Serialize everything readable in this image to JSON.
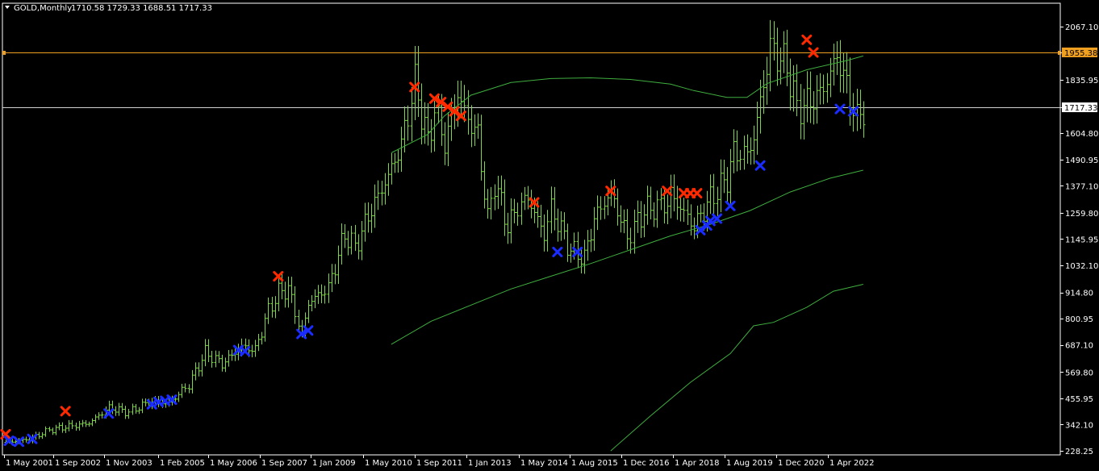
{
  "header": {
    "symbol_period": "GOLD,Monthly",
    "ohlc": "1710.58 1729.33 1688.51 1717.33"
  },
  "colors": {
    "background": "#000000",
    "frame": "#ffffff",
    "bar": "#7fd64a",
    "ma": "#3fae3f",
    "sell_marker": "#ff2a00",
    "buy_marker": "#1a2cff",
    "level_line": "#f0a020",
    "price_line": "#d0d0d0"
  },
  "chart_data": {
    "type": "ohlc",
    "title": "GOLD,Monthly",
    "ylim": [
      228.25,
      2126.0
    ],
    "y_ticks": [
      "2067.10",
      "1955.38",
      "1835.95",
      "1717.33",
      "1604.80",
      "1490.95",
      "1377.10",
      "1259.80",
      "1145.95",
      "1032.10",
      "914.80",
      "800.95",
      "687.10",
      "569.80",
      "455.95",
      "342.10",
      "228.25"
    ],
    "x_ticks": [
      "1 May 2001",
      "1 Sep 2002",
      "1 Nov 2003",
      "1 Feb 2005",
      "1 May 2006",
      "1 Sep 2007",
      "1 Jan 2009",
      "1 May 2010",
      "1 Sep 2011",
      "1 Jan 2013",
      "1 May 2014",
      "1 Aug 2015",
      "1 Dec 2016",
      "1 Apr 2018",
      "1 Aug 2019",
      "1 Dec 2020",
      "1 Apr 2022"
    ],
    "x_start": "2001-05",
    "x_step": "1 month",
    "horizontal_lines": [
      {
        "label": "1955.38",
        "value": 1955.38,
        "kind": "level"
      },
      {
        "label": "1717.33",
        "value": 1717.33,
        "kind": "current-price"
      }
    ],
    "close_anchors": [
      [
        "2001-05",
        265
      ],
      [
        "2001-12",
        278
      ],
      [
        "2002-06",
        318
      ],
      [
        "2002-10",
        330
      ],
      [
        "2003-06",
        348
      ],
      [
        "2003-12",
        415
      ],
      [
        "2004-06",
        395
      ],
      [
        "2004-12",
        440
      ],
      [
        "2005-06",
        435
      ],
      [
        "2005-12",
        515
      ],
      [
        "2006-05",
        655
      ],
      [
        "2006-10",
        605
      ],
      [
        "2007-04",
        680
      ],
      [
        "2007-08",
        665
      ],
      [
        "2007-12",
        835
      ],
      [
        "2008-03",
        915
      ],
      [
        "2008-06",
        930
      ],
      [
        "2008-10",
        730
      ],
      [
        "2008-12",
        870
      ],
      [
        "2009-06",
        935
      ],
      [
        "2009-11",
        1170
      ],
      [
        "2010-02",
        1110
      ],
      [
        "2010-06",
        1245
      ],
      [
        "2010-12",
        1420
      ],
      [
        "2011-04",
        1555
      ],
      [
        "2011-08",
        1825
      ],
      [
        "2011-12",
        1565
      ],
      [
        "2012-02",
        1710
      ],
      [
        "2012-05",
        1560
      ],
      [
        "2012-09",
        1775
      ],
      [
        "2012-12",
        1665
      ],
      [
        "2013-03",
        1595
      ],
      [
        "2013-06",
        1230
      ],
      [
        "2013-08",
        1395
      ],
      [
        "2013-12",
        1200
      ],
      [
        "2014-03",
        1285
      ],
      [
        "2014-06",
        1325
      ],
      [
        "2014-11",
        1165
      ],
      [
        "2015-01",
        1280
      ],
      [
        "2015-07",
        1095
      ],
      [
        "2015-11",
        1065
      ],
      [
        "2016-02",
        1235
      ],
      [
        "2016-07",
        1350
      ],
      [
        "2016-12",
        1150
      ],
      [
        "2017-05",
        1270
      ],
      [
        "2017-12",
        1300
      ],
      [
        "2018-01",
        1340
      ],
      [
        "2018-08",
        1200
      ],
      [
        "2019-01",
        1320
      ],
      [
        "2019-06",
        1410
      ],
      [
        "2019-08",
        1520
      ],
      [
        "2019-12",
        1515
      ],
      [
        "2020-02",
        1585
      ],
      [
        "2020-07",
        1975
      ],
      [
        "2020-12",
        1895
      ],
      [
        "2021-03",
        1710
      ],
      [
        "2021-09",
        1760
      ],
      [
        "2021-12",
        1830
      ],
      [
        "2022-03",
        1940
      ],
      [
        "2022-06",
        1810
      ],
      [
        "2022-09",
        1660
      ],
      [
        "2022-11",
        1717.33
      ]
    ],
    "moving_averages": [
      {
        "points": [
          [
            "2011-01",
            1520
          ],
          [
            "2011-12",
            1600
          ],
          [
            "2012-05",
            1680
          ],
          [
            "2013-01",
            1770
          ],
          [
            "2014-01",
            1825
          ],
          [
            "2015-01",
            1842
          ],
          [
            "2016-01",
            1845
          ],
          [
            "2017-01",
            1838
          ],
          [
            "2018-01",
            1818
          ],
          [
            "2018-08",
            1790
          ],
          [
            "2019-06",
            1760
          ],
          [
            "2019-12",
            1760
          ],
          [
            "2020-06",
            1820
          ],
          [
            "2021-06",
            1880
          ],
          [
            "2022-06",
            1920
          ],
          [
            "2022-11",
            1940
          ]
        ]
      },
      {
        "points": [
          [
            "2011-01",
            690
          ],
          [
            "2012-01",
            790
          ],
          [
            "2013-01",
            860
          ],
          [
            "2014-01",
            930
          ],
          [
            "2015-01",
            985
          ],
          [
            "2016-01",
            1040
          ],
          [
            "2017-01",
            1100
          ],
          [
            "2018-01",
            1160
          ],
          [
            "2019-01",
            1210
          ],
          [
            "2020-01",
            1270
          ],
          [
            "2021-01",
            1350
          ],
          [
            "2022-01",
            1410
          ],
          [
            "2022-11",
            1445
          ]
        ]
      },
      {
        "points": [
          [
            "2016-07",
            228
          ],
          [
            "2017-07",
            380
          ],
          [
            "2018-07",
            525
          ],
          [
            "2019-07",
            650
          ],
          [
            "2020-02",
            770
          ],
          [
            "2020-08",
            785
          ],
          [
            "2021-06",
            850
          ],
          [
            "2022-02",
            920
          ],
          [
            "2022-11",
            950
          ]
        ]
      }
    ],
    "sell_markers": [
      [
        "2001-05",
        300
      ],
      [
        "2002-11",
        400
      ],
      [
        "2008-03",
        985
      ],
      [
        "2011-08",
        1805
      ],
      [
        "2012-02",
        1755
      ],
      [
        "2012-04",
        1740
      ],
      [
        "2012-06",
        1720
      ],
      [
        "2012-08",
        1700
      ],
      [
        "2012-10",
        1680
      ],
      [
        "2014-08",
        1305
      ],
      [
        "2016-07",
        1355
      ],
      [
        "2017-12",
        1355
      ],
      [
        "2018-05",
        1345
      ],
      [
        "2018-07",
        1345
      ],
      [
        "2018-09",
        1345
      ],
      [
        "2021-06",
        2010
      ],
      [
        "2021-08",
        1955
      ]
    ],
    "buy_markers": [
      [
        "2001-06",
        272
      ],
      [
        "2001-09",
        268
      ],
      [
        "2002-01",
        280
      ],
      [
        "2003-12",
        390
      ],
      [
        "2005-01",
        430
      ],
      [
        "2005-03",
        440
      ],
      [
        "2005-05",
        445
      ],
      [
        "2005-07",
        450
      ],
      [
        "2007-03",
        665
      ],
      [
        "2007-05",
        660
      ],
      [
        "2008-10",
        735
      ],
      [
        "2008-12",
        750
      ],
      [
        "2015-03",
        1090
      ],
      [
        "2015-09",
        1090
      ],
      [
        "2018-10",
        1185
      ],
      [
        "2018-12",
        1205
      ],
      [
        "2019-01",
        1225
      ],
      [
        "2019-03",
        1235
      ],
      [
        "2019-07",
        1290
      ],
      [
        "2020-04",
        1465
      ],
      [
        "2022-04",
        1710
      ],
      [
        "2022-08",
        1700
      ]
    ]
  }
}
